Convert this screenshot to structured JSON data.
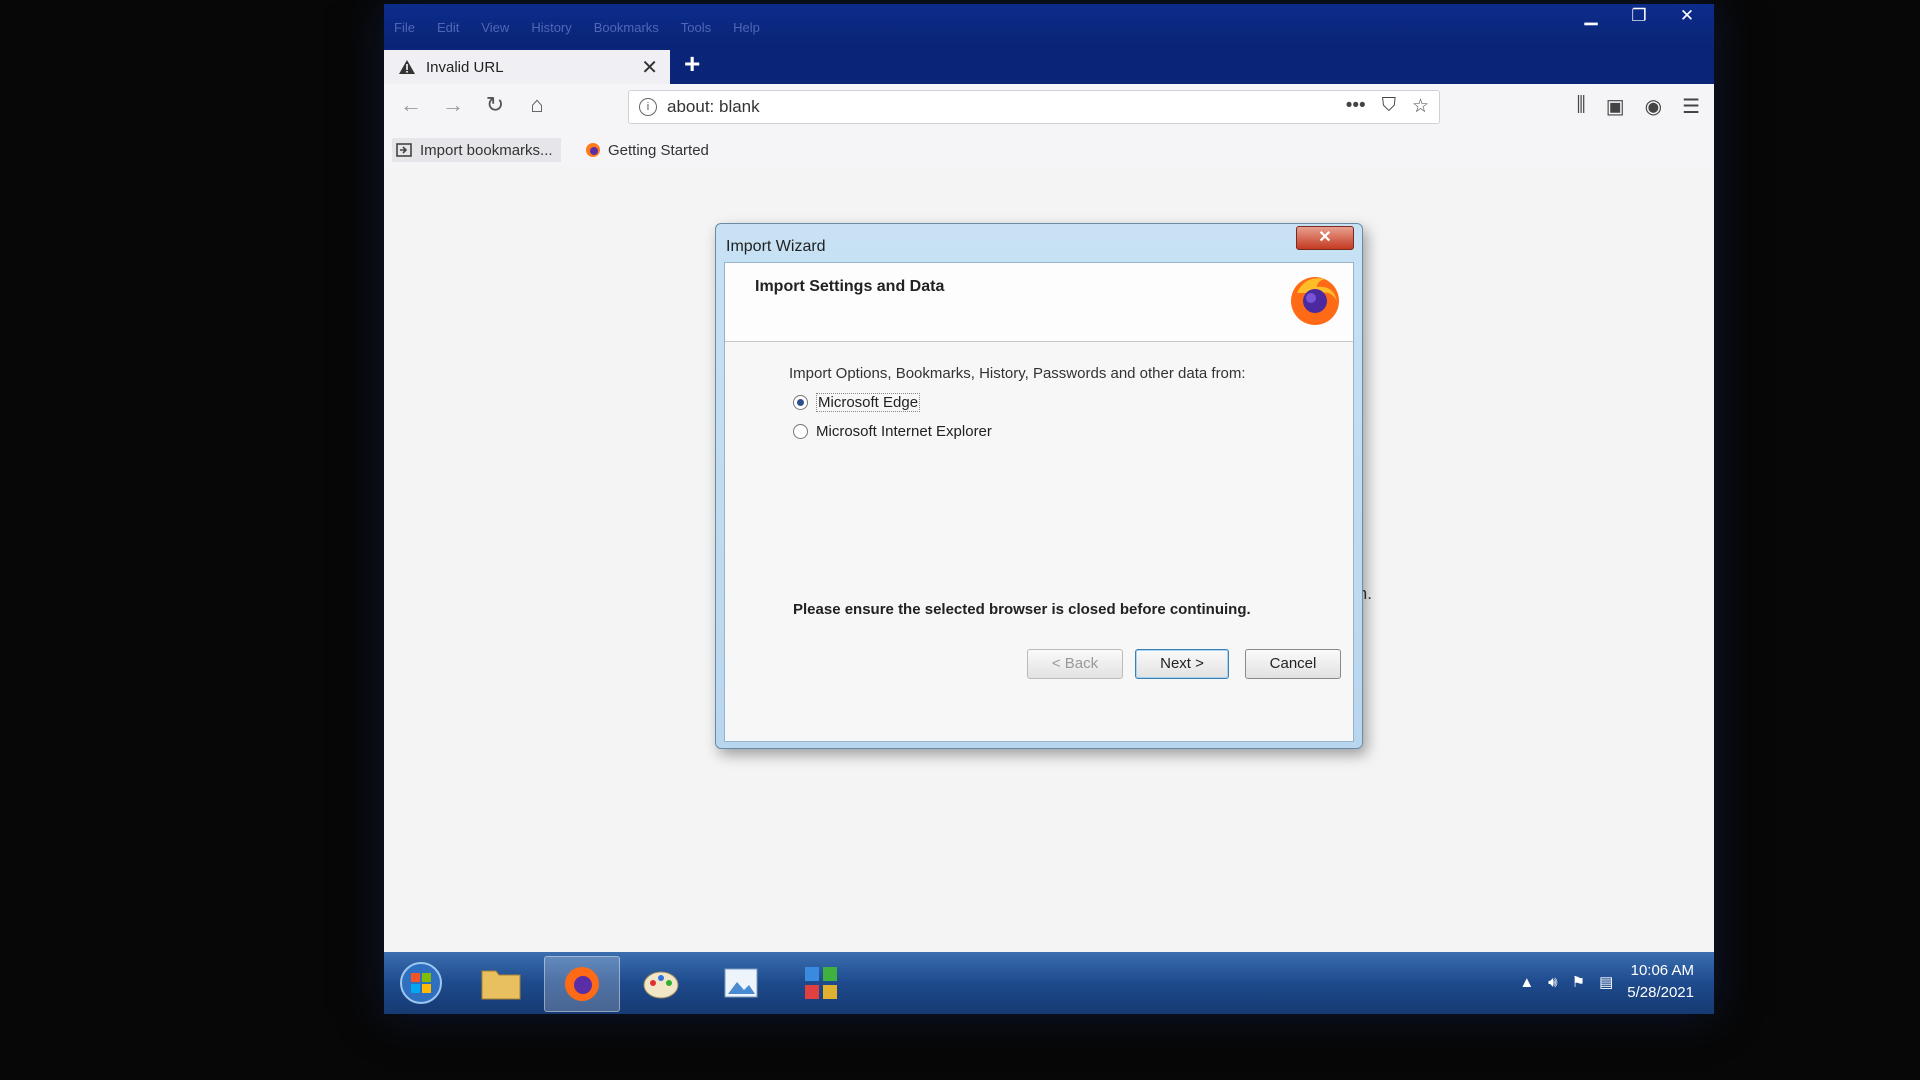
{
  "window": {
    "menu": [
      "File",
      "Edit",
      "View",
      "History",
      "Bookmarks",
      "Tools",
      "Help"
    ],
    "controls": [
      "minimize",
      "maximize",
      "close"
    ]
  },
  "tab": {
    "title": "Invalid URL",
    "close_glyph": "✕",
    "new_tab_glyph": "+"
  },
  "navbar": {
    "url": "about: blank",
    "page_actions_glyph": "•••"
  },
  "bookmarks": [
    {
      "label": "Import bookmarks..."
    },
    {
      "label": "Getting Started"
    }
  ],
  "background_fragment": "in.",
  "dialog": {
    "title": "Import Wizard",
    "close_glyph": "✕",
    "heading": "Import Settings and Data",
    "prompt": "Import Options, Bookmarks, History, Passwords and other data from:",
    "options": [
      {
        "label": "Microsoft Edge",
        "selected": true
      },
      {
        "label": "Microsoft Internet Explorer",
        "selected": false
      }
    ],
    "note": "Please ensure the selected browser is closed before continuing.",
    "buttons": {
      "back": "< Back",
      "next": "Next >",
      "cancel": "Cancel"
    }
  },
  "taskbar": {
    "items": [
      "start-button",
      "file-explorer",
      "firefox",
      "paint",
      "picture-viewer",
      "control-panel"
    ],
    "clock": {
      "time": "10:06 AM",
      "date": "5/28/2021"
    }
  },
  "colors": {
    "titlebar": "#0c2c8c",
    "taskbar": "#1e4a8c",
    "dialog_frame": "#b8d6ee",
    "close_red": "#c43a22"
  }
}
